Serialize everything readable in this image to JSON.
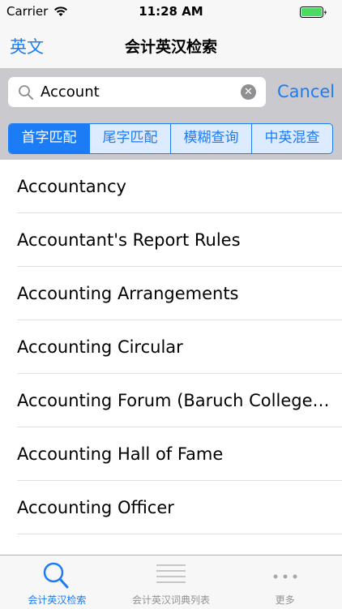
{
  "status_bar": {
    "carrier": "Carrier",
    "time": "11:28 AM"
  },
  "nav": {
    "left_label": "英文",
    "title": "会计英汉检索"
  },
  "search": {
    "query": "Account",
    "cancel_label": "Cancel"
  },
  "segments": [
    {
      "label": "首字匹配",
      "selected": true
    },
    {
      "label": "尾字匹配",
      "selected": false
    },
    {
      "label": "模糊查询",
      "selected": false
    },
    {
      "label": "中英混查",
      "selected": false
    }
  ],
  "results": [
    "Accountancy",
    "Accountant's Report Rules",
    "Accounting Arrangements",
    "Accounting Circular",
    "Accounting Forum (Baruch College…",
    "Accounting Hall of Fame",
    "Accounting Officer"
  ],
  "tabs": [
    {
      "label": "会计英汉检索",
      "icon": "search-icon",
      "active": true
    },
    {
      "label": "会计英汉词典列表",
      "icon": "list-icon",
      "active": false
    },
    {
      "label": "更多",
      "icon": "more-icon",
      "active": false
    }
  ],
  "colors": {
    "accent": "#1b7cf5",
    "battery": "#4cd964"
  }
}
